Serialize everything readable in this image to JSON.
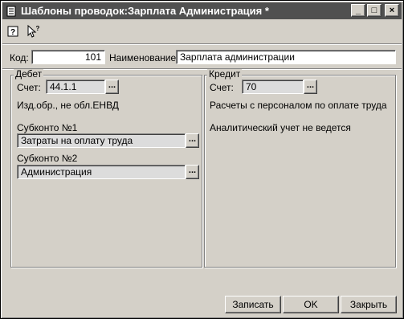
{
  "window": {
    "title": "Шаблоны проводок:Зарплата Администрация *"
  },
  "toolbar": {
    "help_icon": "help-icon",
    "context_help_icon": "pointer-help-icon"
  },
  "header": {
    "kod_label": "Код:",
    "kod_value": "101",
    "name_label": "Наименование:",
    "name_value": "Зарплата администрации"
  },
  "debet": {
    "title": "Дебет",
    "schet_label": "Счет:",
    "schet_value": "44.1.1",
    "schet_desc": "Изд.обр., не обл.ЕНВД",
    "subkonto1_label": "Субконто №1",
    "subkonto1_value": "Затраты на оплату труда",
    "subkonto2_label": "Субконто №2",
    "subkonto2_value": "Администрация"
  },
  "kredit": {
    "title": "Кредит",
    "schet_label": "Счет:",
    "schet_value": "70",
    "schet_desc": "Расчеты с персоналом по оплате труда",
    "analytic_note": "Аналитический учет не ведется"
  },
  "buttons": {
    "ellipsis": "...",
    "save": "Записать",
    "ok": "OK",
    "close": "Закрыть"
  },
  "titlebar_buttons": {
    "minimize": "_",
    "maximize": "□",
    "close": "×"
  }
}
